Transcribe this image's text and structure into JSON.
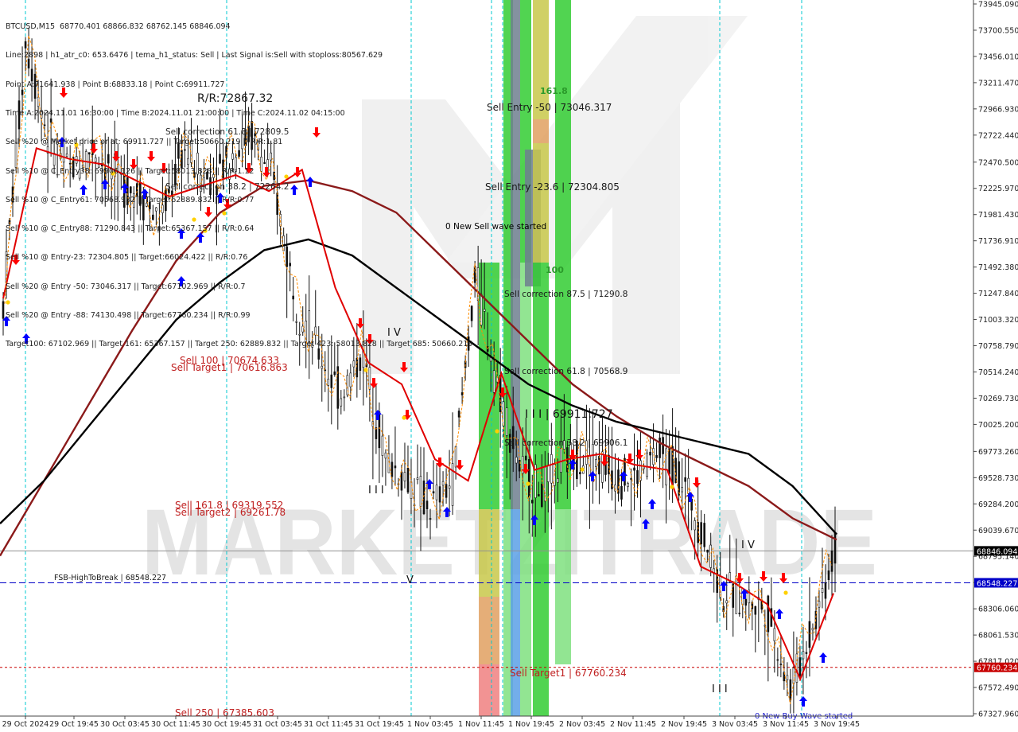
{
  "symbol": "BTCUSD,M15",
  "header": {
    "title_line": "BTCUSD,M15  68770.401 68866.832 68762.145 68846.094",
    "lines": [
      "Line:2898 | h1_atr_c0: 653.6476 | tema_h1_status: Sell | Last Signal is:Sell with stoploss:80567.629",
      "Point A:71641.938 | Point B:68833.18 | Point C:69911.727",
      "Time A:2024.11.01 16:30:00 | Time B:2024.11.01 21:00:00 | Time C:2024.11.02 04:15:00",
      "Sell %20 @ Market price or at: 69911.727 || Target:50660.219 || R/R:1.81",
      "Sell %10 @ C_Entry38: 69906.126 || Target:58013.828 || R/R:1.12",
      "Sell %10 @ C_Entry61: 70568.932 || Target:62889.832 || R/R:0.77",
      "Sell %10 @ C_Entry88: 71290.843 || Target:65367.157 || R/R:0.64",
      "Sell %10 @ Entry-23: 72304.805 || Target:66024.422 || R/R:0.76",
      "Sell %20 @ Entry -50: 73046.317 || Target:67102.969 || R/R:0.7",
      "Sell %20 @ Entry -88: 74130.498 || Target:67760.234 || R/R:0.99",
      "Target100: 67102.969 || Target 161: 65367.157 || Target 250: 62889.832 || Target 423: 58013.828 || Target 685: 50660.219"
    ],
    "overlay_label": "0 New Sell wave started"
  },
  "price_axis": {
    "ticks": [
      "73945.090",
      "73700.550",
      "73456.010",
      "73211.470",
      "72966.930",
      "72722.440",
      "72470.500",
      "72225.970",
      "71981.430",
      "71736.910",
      "71492.380",
      "71247.840",
      "71003.320",
      "70758.790",
      "70514.240",
      "70269.730",
      "70025.200",
      "69773.260",
      "69528.730",
      "69284.200",
      "69039.670",
      "68795.140",
      "68550.600",
      "68306.060",
      "68061.530",
      "67817.020",
      "67572.490",
      "67327.960"
    ],
    "current_price": "68846.094",
    "fsb_price": "68548.227",
    "target_price": "67760.234"
  },
  "time_axis": {
    "labels": [
      "29 Oct 2024",
      "29 Oct 19:45",
      "30 Oct 03:45",
      "30 Oct 11:45",
      "30 Oct 19:45",
      "31 Oct 03:45",
      "31 Oct 11:45",
      "31 Oct 19:45",
      "1 Nov 03:45",
      "1 Nov 11:45",
      "1 Nov 19:45",
      "2 Nov 03:45",
      "2 Nov 11:45",
      "2 Nov 19:45",
      "3 Nov 03:45",
      "3 Nov 11:45",
      "3 Nov 19:45"
    ]
  },
  "annotations": {
    "rr_level": "R/R:72867.32",
    "sell_correction_top": "Sell correction 61.8 | 72809.5",
    "sell_correction_mid": "Sell correction 38.2 | 72264.2",
    "sell_entry_50": "Sell Entry -50 | 73046.317",
    "sell_entry_23": "Sell Entry -23.6 | 72304.805",
    "new_sell_wave": "0 New Sell wave started",
    "sell_correction_875": "Sell correction 87.5 | 71290.8",
    "sell_correction_618": "Sell correction 61.8 | 70568.9",
    "sell_correction_382": "Sell correction 38.2 | 69906.1",
    "point_c": "I I I | 69911.727",
    "sell_100": "Sell 100 | 70674.633",
    "sell_target1_top": "Sell Target1 | 70616.863",
    "sell_1618": "Sell 161.8 | 69319.552",
    "sell_target2": "Sell Target2 | 69261.78",
    "fsb_label": "FSB-HighToBreak | 68548.227",
    "sell_target1": "Sell Target1 | 67760.234",
    "sell_250": "Sell  250 | 67385.603",
    "new_buy_wave": "0 New Buy Wave started",
    "wave_iv_1": "I V",
    "wave_iii_1": "I I I",
    "wave_v": "V",
    "wave_iv_2": "I V",
    "wave_iii_2": "I I I",
    "zone_161": "161.8",
    "zone_100": "100",
    "watermark": "MARKETZITRADE"
  },
  "colors": {
    "background": "#ffffff",
    "ma_black": "#000000",
    "ma_darkred": "#8b1a1a",
    "ma_red": "#e00000",
    "orange_dash": "#ff8c00",
    "cyan_vline": "#00c8d0",
    "blue_hline": "#0000c8",
    "red_hline": "#c80000",
    "zone_green_bright": "#33cc33",
    "zone_green_light": "#7fe07f",
    "zone_yellow": "#c8c84a",
    "zone_orange": "#e0a060",
    "zone_salmon": "#f08080",
    "zone_slate": "#6f7f8f",
    "zone_blue": "#5aa0e6",
    "arrow_up": "#0000ff",
    "arrow_down": "#ff0000",
    "star": "#ffd000",
    "watermark": "#cfcfcf",
    "watermark_accent": "#ff9999",
    "price_tag_current": "#000000",
    "price_tag_fsb": "#0000c8",
    "price_tag_target": "#c80000"
  },
  "chart_data": {
    "type": "candlestick",
    "title": "BTCUSD,M15",
    "ylim": [
      67327.96,
      73945.09
    ],
    "x": [
      "29 Oct 2024",
      "29 Oct 19:45",
      "30 Oct 03:45",
      "30 Oct 11:45",
      "30 Oct 19:45",
      "31 Oct 03:45",
      "31 Oct 11:45",
      "31 Oct 19:45",
      "1 Nov 03:45",
      "1 Nov 11:45",
      "1 Nov 19:45",
      "2 Nov 03:45",
      "2 Nov 11:45",
      "2 Nov 19:45",
      "3 Nov 03:45",
      "3 Nov 11:45",
      "3 Nov 19:45"
    ],
    "close_path": [
      71150,
      73600,
      72700,
      72400,
      72600,
      72300,
      72200,
      71900,
      72600,
      72300,
      72500,
      72750,
      72300,
      71200,
      70700,
      70300,
      70700,
      69700,
      69500,
      69250,
      69500,
      71400,
      70400,
      69600,
      69400,
      69700,
      69750,
      69600,
      69500,
      69750,
      69600,
      69100,
      68450,
      68400,
      68300,
      67550,
      68150,
      68850
    ],
    "ma_black": [
      69100,
      69500,
      70000,
      70500,
      71000,
      71350,
      71650,
      71750,
      71600,
      71300,
      71000,
      70700,
      70400,
      70200,
      70050,
      69950,
      69850,
      69750,
      69450,
      69000
    ],
    "ma_darkred": [
      68800,
      69500,
      70200,
      70900,
      71550,
      72000,
      72250,
      72300,
      72200,
      72000,
      71600,
      71200,
      70800,
      70400,
      70100,
      69850,
      69650,
      69450,
      69150,
      68950
    ],
    "ma_red": [
      71200,
      72600,
      72500,
      72450,
      72300,
      72150,
      72250,
      72350,
      72200,
      72400,
      71300,
      70600,
      70400,
      69700,
      69500,
      70500,
      69600,
      69700,
      69750,
      69650,
      69600,
      68700,
      68550,
      68350,
      67650,
      68450
    ],
    "levels": {
      "current": 68846.094,
      "fsb_high_to_break": 68548.227,
      "sell_target1": 67760.234
    }
  }
}
